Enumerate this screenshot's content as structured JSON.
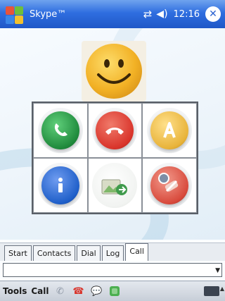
{
  "titlebar": {
    "app_title": "Skype™",
    "clock": "12:16",
    "close_glyph": "✕"
  },
  "icons": {
    "start": "windows-flag-icon",
    "signal": "signal-icon",
    "speaker": "speaker-icon",
    "avatar": "smiley-avatar-icon"
  },
  "grid": {
    "cells": [
      {
        "name": "call-button",
        "icon": "phone-icon",
        "color": "#1f8a3c"
      },
      {
        "name": "hangup-button",
        "icon": "hangup-icon",
        "color": "#d9342b"
      },
      {
        "name": "add-contact-button",
        "icon": "contact-a-icon",
        "color": "#e8b33a"
      },
      {
        "name": "info-button",
        "icon": "info-icon",
        "color": "#1f5fc9"
      },
      {
        "name": "send-file-button",
        "icon": "send-file-icon",
        "color": "#7fb86a"
      },
      {
        "name": "block-button",
        "icon": "block-icon",
        "color": "#d84a3c"
      }
    ]
  },
  "tabs": [
    "Start",
    "Contacts",
    "Dial",
    "Log",
    "Call"
  ],
  "active_tab": "Call",
  "address": {
    "value": ""
  },
  "menubar": {
    "tools_label": "Tools",
    "call_label": "Call"
  },
  "colors": {
    "titlebar": "#2f6ee0",
    "accent_green": "#1f8a3c",
    "accent_red": "#d9342b"
  }
}
